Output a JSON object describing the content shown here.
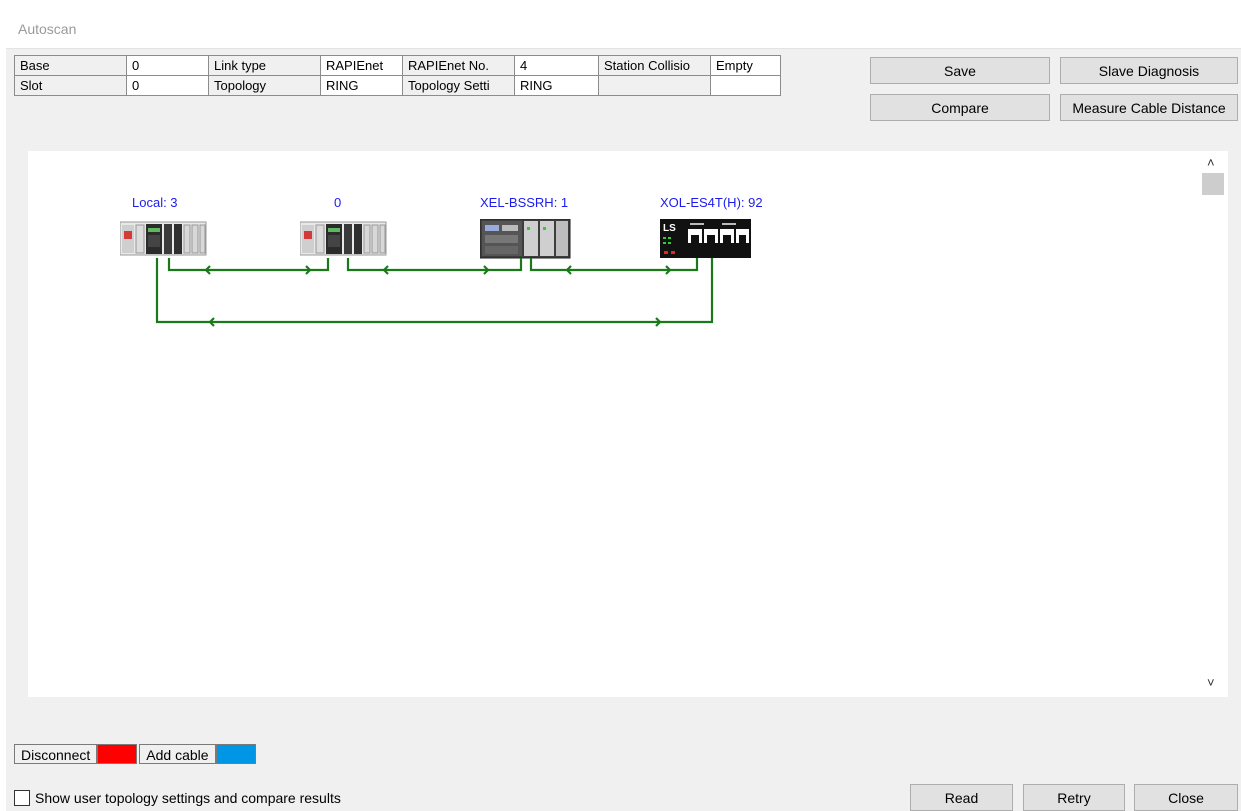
{
  "window": {
    "title": "Autoscan"
  },
  "info_table": [
    {
      "label": "Base",
      "value": "0"
    },
    {
      "label": "Link type",
      "value": "RAPIEnet"
    },
    {
      "label": "RAPIEnet No.",
      "value": "4"
    },
    {
      "label": "Station Collisio",
      "value": "Empty"
    },
    {
      "label": "Slot",
      "value": "0"
    },
    {
      "label": "Topology",
      "value": "RING"
    },
    {
      "label": "Topology Setti",
      "value": "RING"
    },
    {
      "label": "",
      "value": ""
    }
  ],
  "buttons": {
    "save": "Save",
    "slave_diagnosis": "Slave Diagnosis",
    "compare": "Compare",
    "measure_cable_distance": "Measure Cable Distance",
    "read": "Read",
    "retry": "Retry",
    "close": "Close"
  },
  "topology": {
    "nodes": [
      {
        "label": "Local: 3",
        "type": "plc"
      },
      {
        "label": "0",
        "type": "plc"
      },
      {
        "label": "XEL-BSSRH: 1",
        "type": "smart-io"
      },
      {
        "label": "XOL-ES4T(H): 92",
        "type": "ethernet-switch",
        "logo_text": "LS"
      }
    ],
    "link_color": "#1a7a1a",
    "label_color": "#1b1bf0"
  },
  "legend": [
    {
      "label": "Disconnect",
      "color": "#ff0000"
    },
    {
      "label": "Add cable",
      "color": "#0096e6"
    }
  ],
  "options": {
    "show_user_topology_label": "Show user topology settings and compare results",
    "checked": false
  },
  "scrollbar": {
    "up_icon": "chevron-up-icon",
    "down_icon": "chevron-down-icon"
  }
}
